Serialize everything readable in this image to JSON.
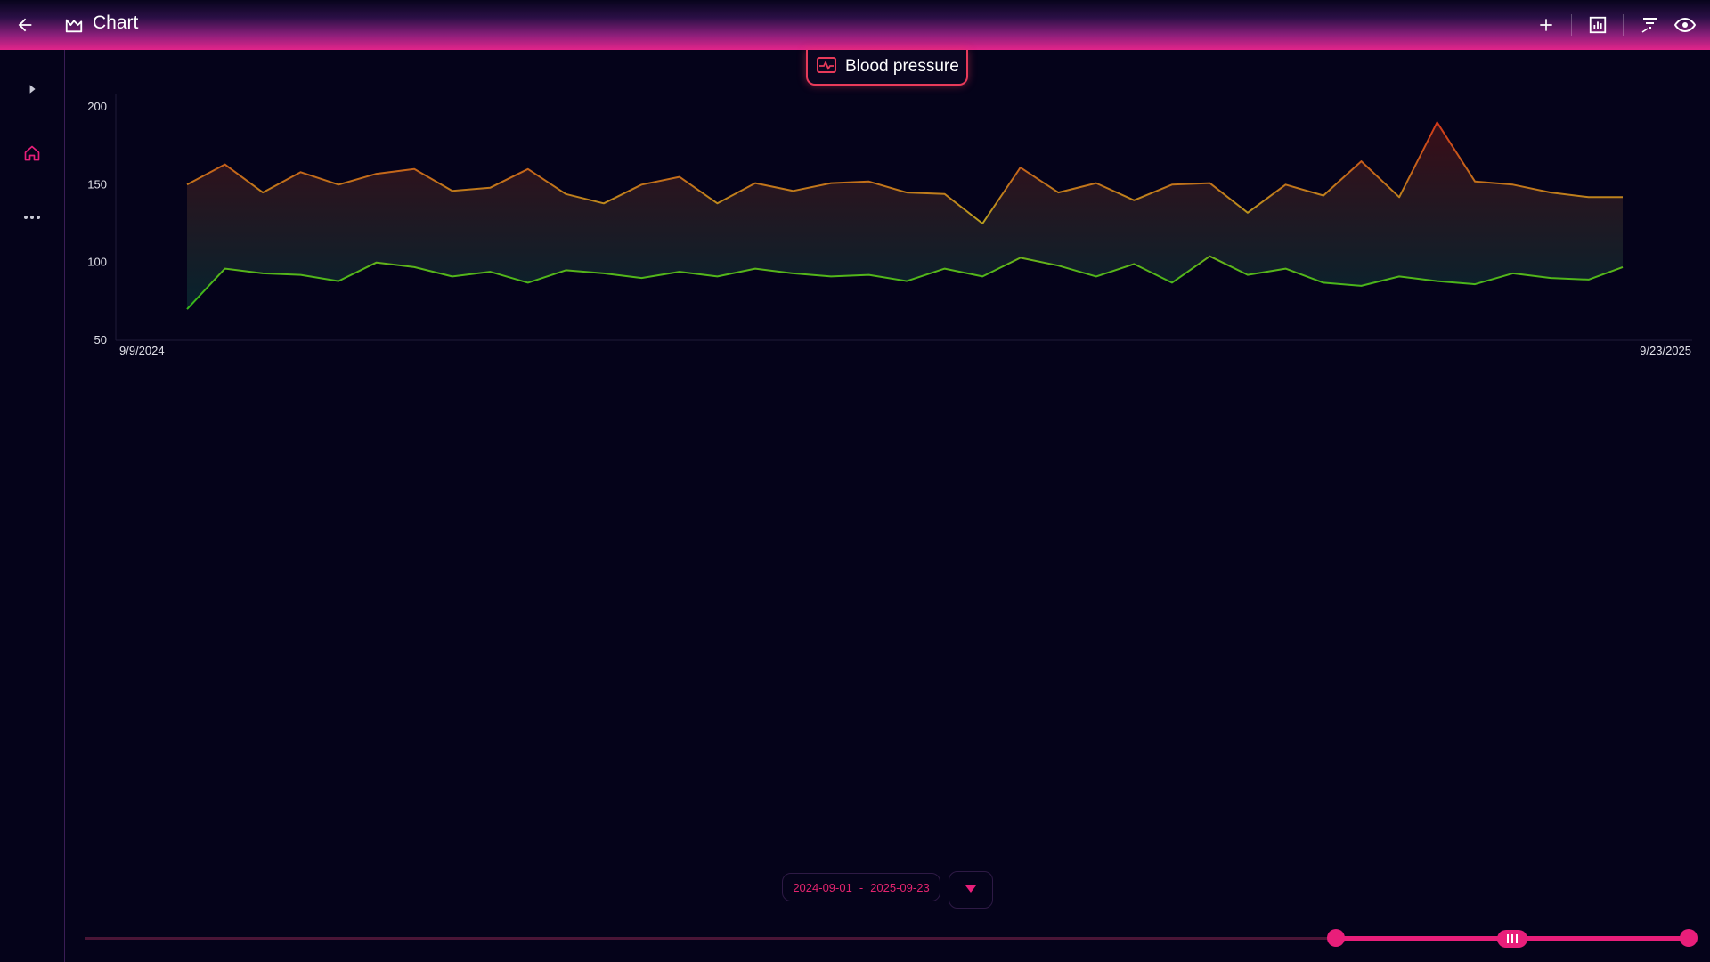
{
  "app": {
    "title": "Chart"
  },
  "chart_tab": {
    "label": "Blood pressure"
  },
  "date_range": {
    "start": "2024-09-01",
    "separator": "-",
    "end": "2025-09-23"
  },
  "slider": {
    "start_fraction": 0.78,
    "handle_fraction": 0.89,
    "end_fraction": 1.0
  },
  "colors": {
    "accent": "#e91e7a",
    "high": "#d42a1a",
    "mid": "#b8a020",
    "low": "#2ab81a",
    "background": "#05031a"
  },
  "icons": {
    "back": "arrow-left-icon",
    "chart": "area-chart-icon",
    "add": "plus-icon",
    "report": "bar-chart-box-icon",
    "filter": "filter-off-icon",
    "visibility": "eye-icon",
    "expand": "chevron-right-icon",
    "home": "home-icon",
    "more": "more-horizontal-icon",
    "vitals": "heart-pulse-icon",
    "dropdown": "triangle-down-icon"
  },
  "chart_data": {
    "type": "area",
    "title": "",
    "x_range": [
      "2024-09-09",
      "2025-09-23"
    ],
    "x_tick_labels": [
      "9/9/2024",
      "9/23/2025"
    ],
    "y_ticks": [
      200,
      150,
      100,
      50
    ],
    "ylim": [
      50,
      208
    ],
    "grid": false,
    "series": [
      {
        "x": [
          "2024-09-09",
          "2024-09-19",
          "2024-09-29",
          "2024-10-09",
          "2024-10-19",
          "2024-10-29",
          "2024-11-08",
          "2024-11-18",
          "2024-11-28",
          "2024-12-08",
          "2024-12-18",
          "2024-12-28",
          "2025-01-07",
          "2025-01-17",
          "2025-01-27",
          "2025-02-06",
          "2025-02-16",
          "2025-02-26",
          "2025-03-08",
          "2025-03-18",
          "2025-03-28",
          "2025-04-07",
          "2025-04-17",
          "2025-04-27",
          "2025-05-07",
          "2025-05-17",
          "2025-05-27",
          "2025-06-06",
          "2025-06-16",
          "2025-06-26",
          "2025-07-06",
          "2025-07-16",
          "2025-07-26",
          "2025-08-05",
          "2025-08-15",
          "2025-08-25",
          "2025-09-04",
          "2025-09-14",
          "2025-09-23"
        ],
        "values": [
          150,
          163,
          145,
          158,
          150,
          157,
          160,
          146,
          148,
          160,
          144,
          138,
          150,
          155,
          138,
          151,
          146,
          151,
          152,
          145,
          144,
          125,
          161,
          145,
          151,
          140,
          150,
          151,
          132,
          150,
          143,
          165,
          142,
          190,
          152,
          150,
          145,
          142,
          142
        ]
      },
      {
        "x": [
          "2024-09-09",
          "2024-09-19",
          "2024-09-29",
          "2024-10-09",
          "2024-10-19",
          "2024-10-29",
          "2024-11-08",
          "2024-11-18",
          "2024-11-28",
          "2024-12-08",
          "2024-12-18",
          "2024-12-28",
          "2025-01-07",
          "2025-01-17",
          "2025-01-27",
          "2025-02-06",
          "2025-02-16",
          "2025-02-26",
          "2025-03-08",
          "2025-03-18",
          "2025-03-28",
          "2025-04-07",
          "2025-04-17",
          "2025-04-27",
          "2025-05-07",
          "2025-05-17",
          "2025-05-27",
          "2025-06-06",
          "2025-06-16",
          "2025-06-26",
          "2025-07-06",
          "2025-07-16",
          "2025-07-26",
          "2025-08-05",
          "2025-08-15",
          "2025-08-25",
          "2025-09-04",
          "2025-09-14",
          "2025-09-23"
        ],
        "values": [
          70,
          96,
          93,
          92,
          88,
          100,
          97,
          91,
          94,
          87,
          95,
          93,
          90,
          94,
          91,
          96,
          93,
          91,
          92,
          88,
          96,
          91,
          103,
          98,
          91,
          99,
          87,
          104,
          92,
          96,
          87,
          85,
          91,
          88,
          86,
          93,
          90,
          89,
          97
        ]
      }
    ]
  }
}
